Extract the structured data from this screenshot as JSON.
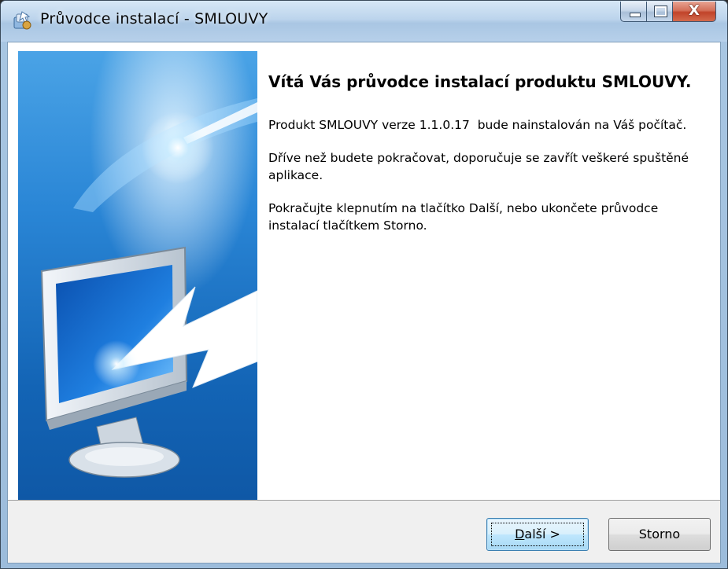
{
  "window": {
    "title": "Průvodce instalací - SMLOUVY",
    "title_icon": "installer-icon"
  },
  "caption_buttons": {
    "minimize_icon": "minimize-icon",
    "maximize_icon": "maximize-icon",
    "close_icon": "close-icon",
    "close_glyph": "X"
  },
  "banner": {
    "image": "wizard-monitor-arrow-graphic"
  },
  "content": {
    "heading": "Vítá Vás průvodce instalací produktu SMLOUVY.",
    "paragraphs": [
      "Produkt SMLOUVY verze 1.1.0.17  bude nainstalován na Váš počítač.",
      "Dříve než budete pokračovat, doporučuje se zavřít veškeré spuštěné aplikace.",
      "Pokračujte klepnutím na tlačítko Další, nebo ukončete průvodce instalací tlačítkem Storno."
    ]
  },
  "buttons": {
    "next_accel": "D",
    "next_rest": "alší >",
    "cancel": "Storno"
  },
  "colors": {
    "banner_blue": "#1e6fc3",
    "footer_bg": "#f0f0f0",
    "close_red": "#c1432a"
  }
}
